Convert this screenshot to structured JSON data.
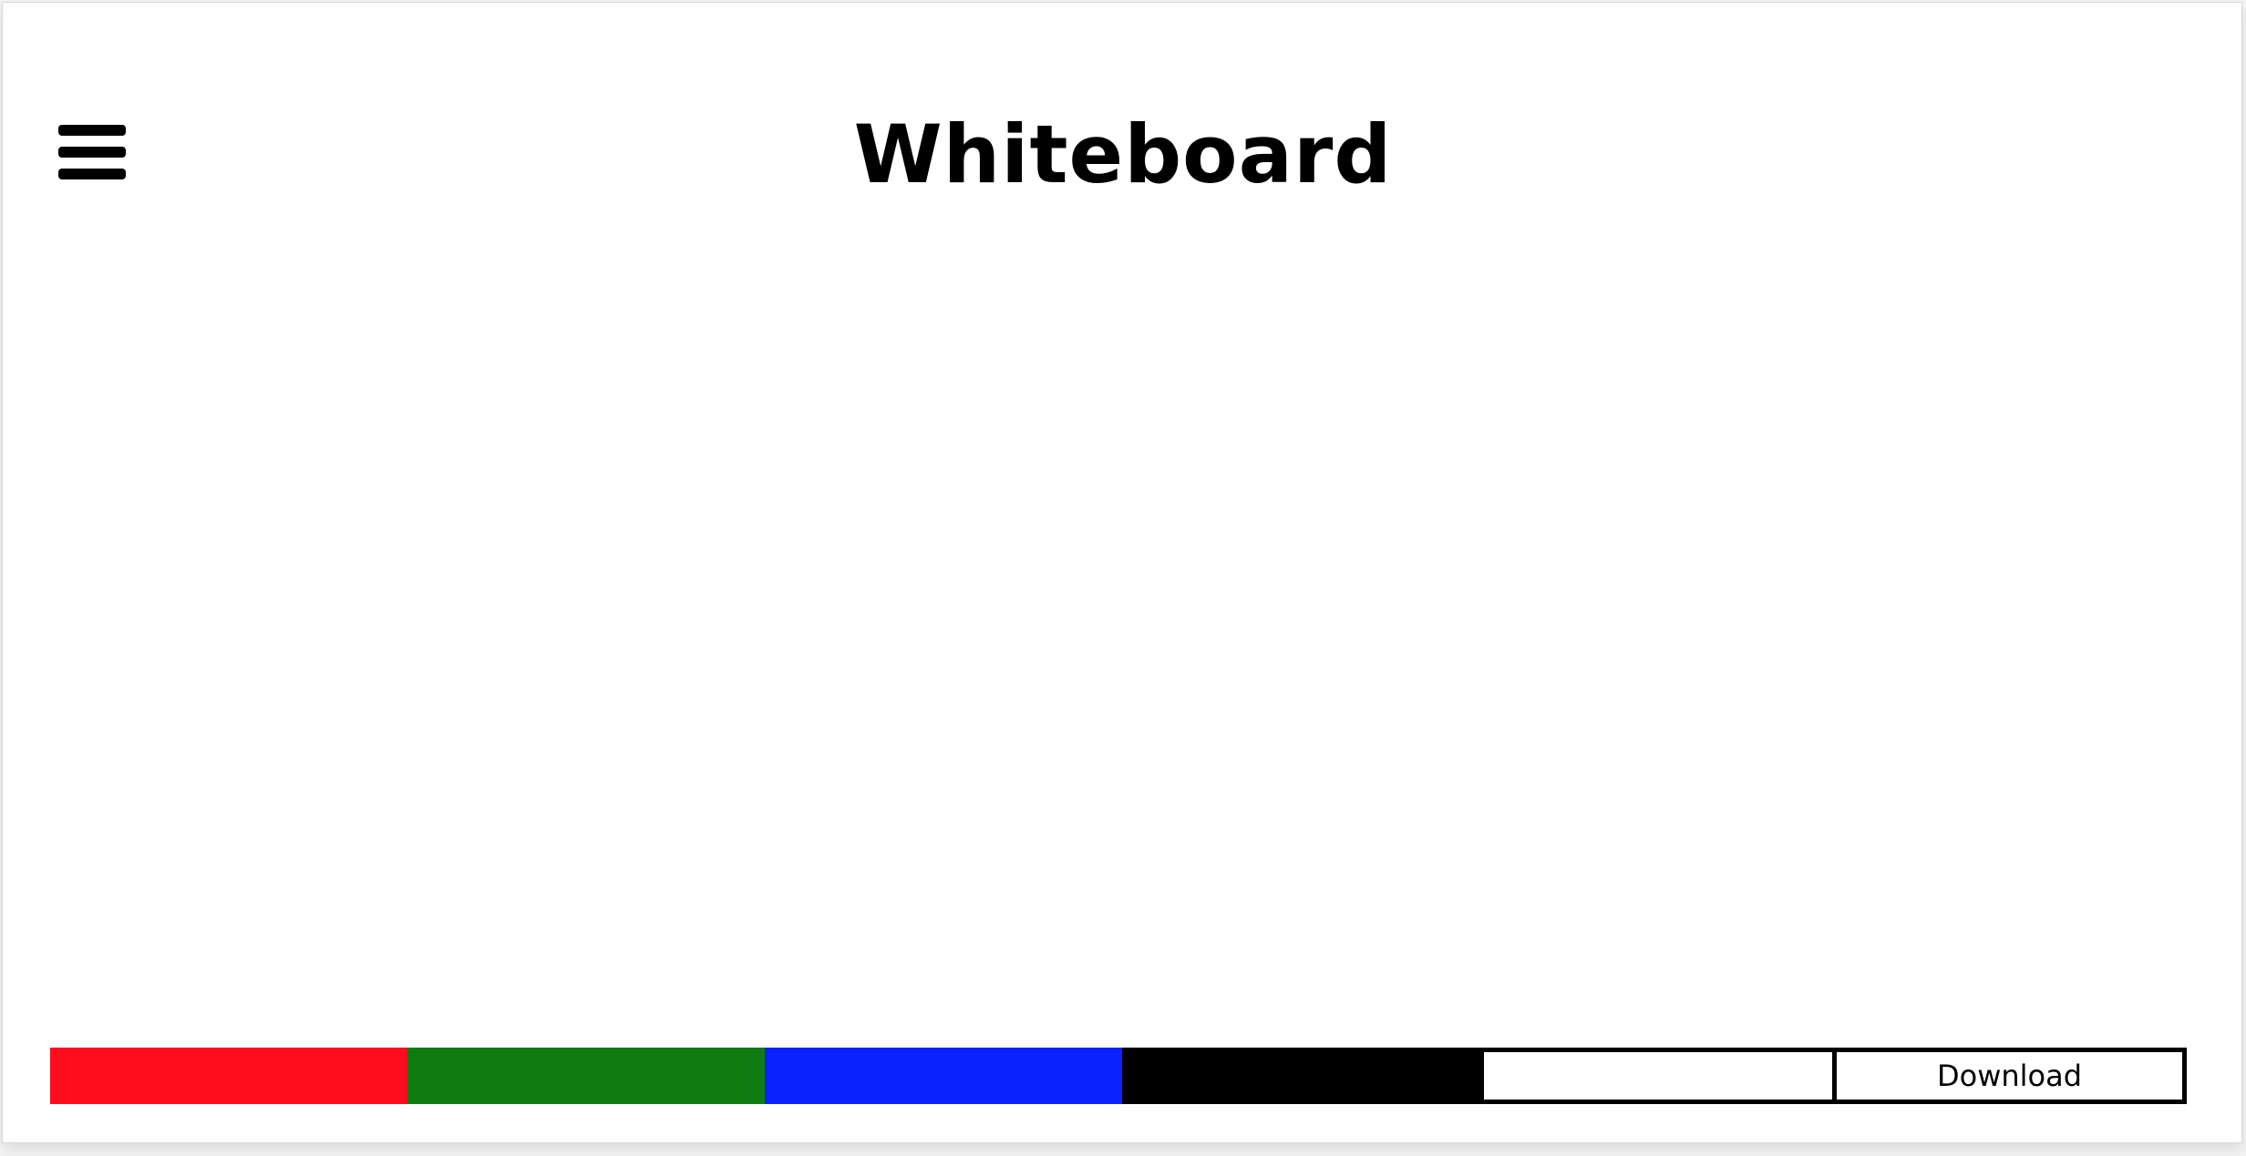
{
  "app": {
    "title": "Whiteboard"
  },
  "header": {
    "menu_icon": "hamburger-menu-icon"
  },
  "toolbar": {
    "colors": [
      {
        "name": "red",
        "hex": "#ff0d1d"
      },
      {
        "name": "green",
        "hex": "#0f7c12"
      },
      {
        "name": "blue",
        "hex": "#0b22ff"
      },
      {
        "name": "black",
        "hex": "#000000"
      },
      {
        "name": "white",
        "hex": "#ffffff"
      }
    ],
    "download_label": "Download"
  }
}
